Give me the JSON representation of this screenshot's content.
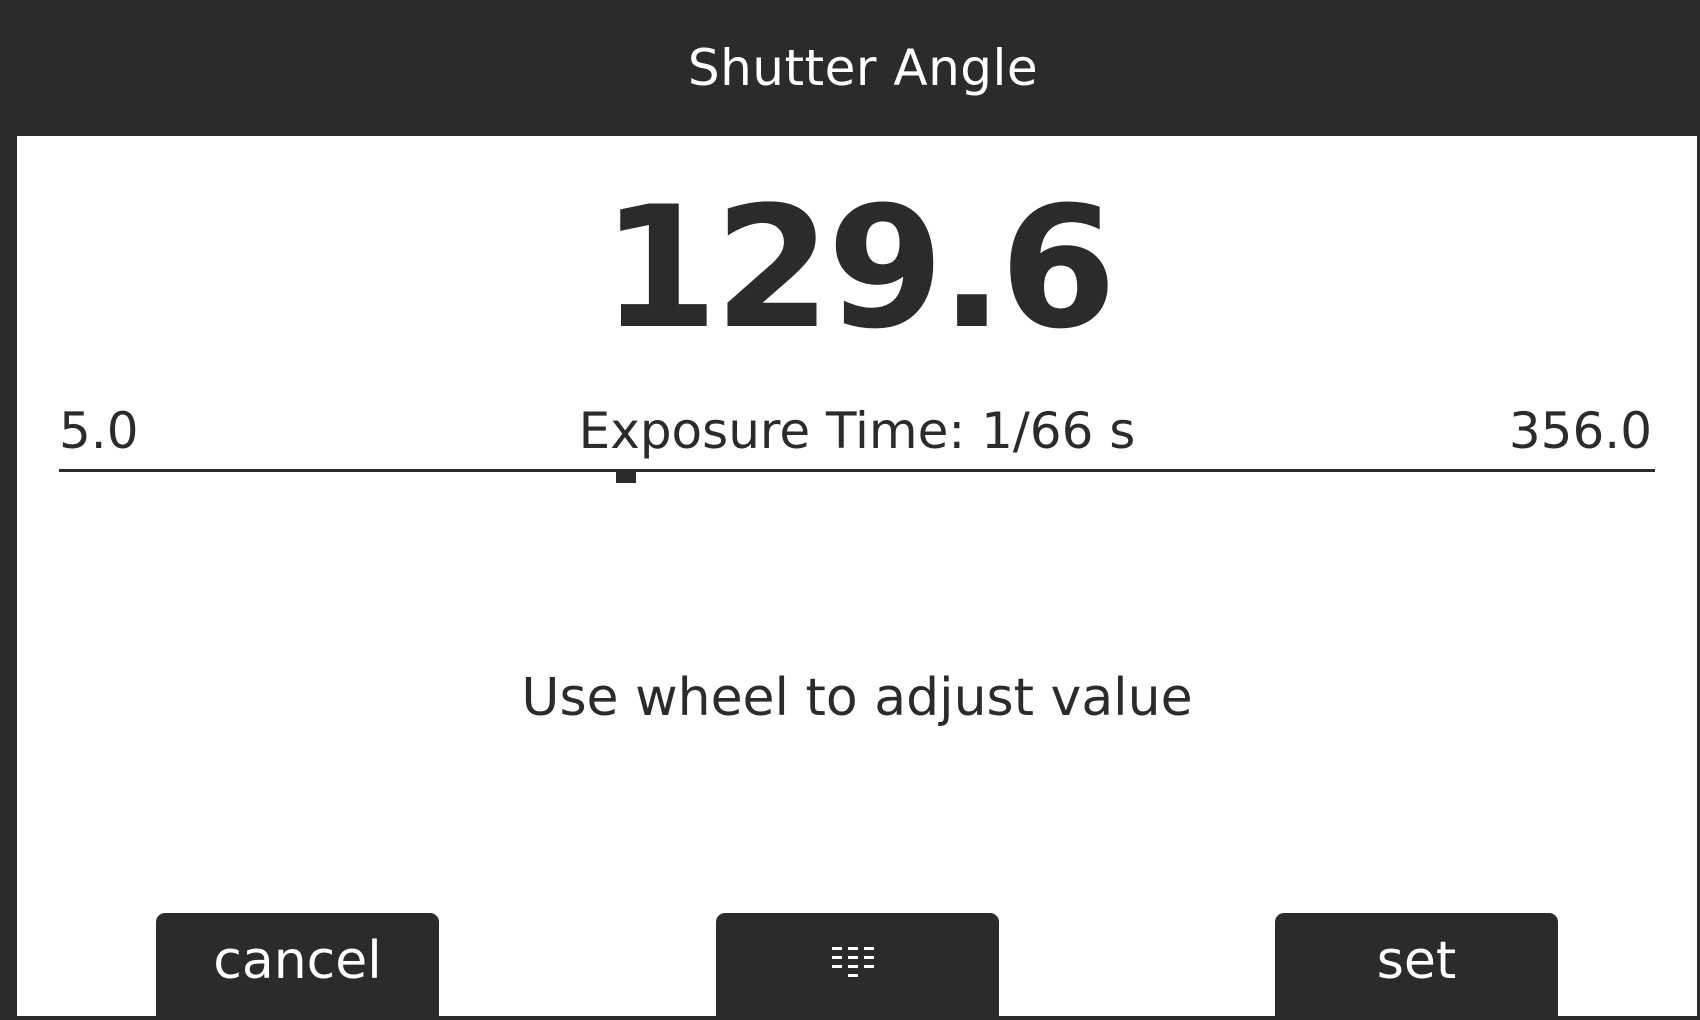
{
  "header": {
    "title": "Shutter Angle"
  },
  "value": {
    "current": "129.6"
  },
  "slider": {
    "min_label": "5.0",
    "max_label": "356.0",
    "min": 5.0,
    "max": 356.0,
    "value": 129.6
  },
  "exposure": {
    "text": "Exposure Time: 1/66 s"
  },
  "hint": {
    "text": "Use wheel to adjust value"
  },
  "buttons": {
    "cancel_label": "cancel",
    "keypad_icon": "keypad-icon",
    "set_label": "set"
  },
  "colors": {
    "background": "#2b2b2b",
    "panel": "#ffffff",
    "text_dark": "#2b2b2b",
    "text_light": "#ffffff"
  }
}
